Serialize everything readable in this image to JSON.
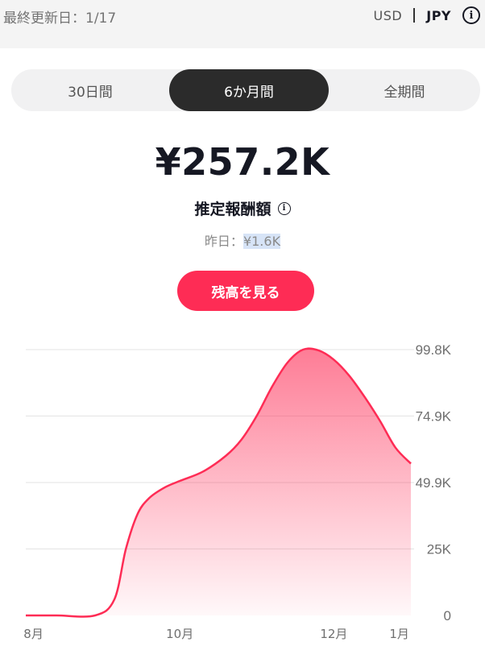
{
  "header": {
    "last_updated": "最終更新日：1/17",
    "currency_usd": "USD",
    "currency_jpy": "JPY",
    "info_glyph": "i"
  },
  "tabs": [
    {
      "label": "30日間",
      "active": false
    },
    {
      "label": "6か月間",
      "active": true
    },
    {
      "label": "全期間",
      "active": false
    }
  ],
  "summary": {
    "amount": "¥257.2K",
    "label": "推定報酬額",
    "info_glyph": "i",
    "yesterday_label": "昨日：",
    "yesterday_value": "¥1.6K"
  },
  "balance_button": "残高を見る",
  "colors": {
    "accent": "#fe2c55",
    "active_tab": "#2b2b2b"
  },
  "chart_data": {
    "type": "area",
    "x_categories": [
      "8月",
      "10月",
      "12月",
      "1月"
    ],
    "y_tick_labels": [
      "99.8K",
      "74.9K",
      "49.9K",
      "25K",
      "0"
    ],
    "y_tick_values": [
      99800,
      74900,
      49900,
      25000,
      0
    ],
    "ylim": [
      0,
      99800
    ],
    "grid": true,
    "series": [
      {
        "x": [
          0,
          0.08,
          0.18,
          0.23,
          0.26,
          0.29,
          0.32,
          0.36,
          0.4,
          0.46,
          0.52,
          0.56,
          0.6,
          0.64,
          0.68,
          0.72,
          0.76,
          0.8,
          0.84,
          0.88,
          0.92,
          0.96,
          1.0
        ],
        "y": [
          0,
          0,
          0,
          6000,
          25000,
          38000,
          44000,
          48000,
          50500,
          54000,
          60000,
          66000,
          75000,
          86000,
          95000,
          99800,
          99500,
          96000,
          90000,
          82000,
          73000,
          63000,
          57000
        ]
      }
    ]
  }
}
